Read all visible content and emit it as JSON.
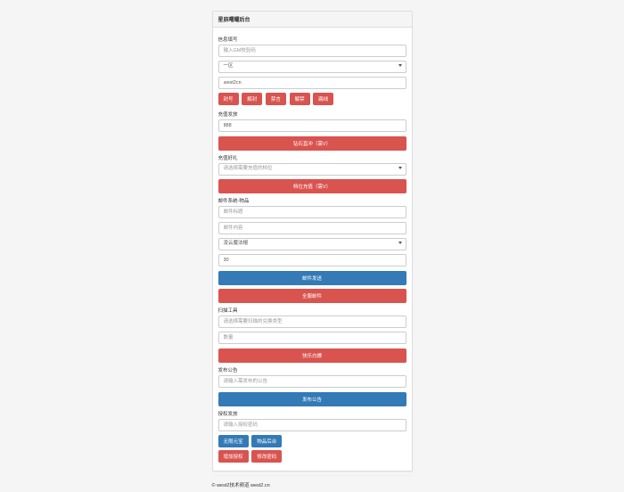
{
  "header": {
    "title": "星辰曙耀后台"
  },
  "info": {
    "label": "信息填写",
    "gm_placeholder": "输入GM校验码",
    "zone_selected": "一区",
    "cn_value": "west2cn"
  },
  "action_buttons": [
    {
      "name": "ban",
      "label": "封号"
    },
    {
      "name": "unban",
      "label": "解封"
    },
    {
      "name": "mute",
      "label": "禁言"
    },
    {
      "name": "unmute",
      "label": "解禁"
    },
    {
      "name": "kick",
      "label": "踢线"
    }
  ],
  "recharge": {
    "label": "充值发放",
    "value": "888",
    "button": "钻石直冲（需V）"
  },
  "gift": {
    "label": "充值好礼",
    "placeholder": "请选择需要充值的档位",
    "button": "档位充值（需V）"
  },
  "mail": {
    "label": "邮件系统-物品",
    "title_placeholder": "邮件标题",
    "content_placeholder": "邮件内容",
    "item_selected": "凌云魔法帽",
    "count_value": "30",
    "send_button": "邮件发送",
    "all_button": "全服邮件"
  },
  "scan": {
    "label": "扫描工具",
    "placeholder": "请选择需要扫描的兑换类型",
    "qty_placeholder": "数量",
    "button": "快乐白嫖"
  },
  "notice": {
    "label": "发布公告",
    "placeholder": "请输入需发布的公告",
    "button": "发布公告"
  },
  "auth": {
    "label": "授权发放",
    "placeholder": "请输入授权密码"
  },
  "bottom_buttons": [
    {
      "name": "unlimited",
      "label": "无限元宝",
      "color": "blue"
    },
    {
      "name": "item-backend",
      "label": "物品后台",
      "color": "blue"
    },
    {
      "name": "add-auth",
      "label": "增加授权",
      "color": "red"
    },
    {
      "name": "change-pwd",
      "label": "修改密码",
      "color": "red"
    }
  ],
  "footer": {
    "text": "© west2技术频道 west2.cn"
  }
}
